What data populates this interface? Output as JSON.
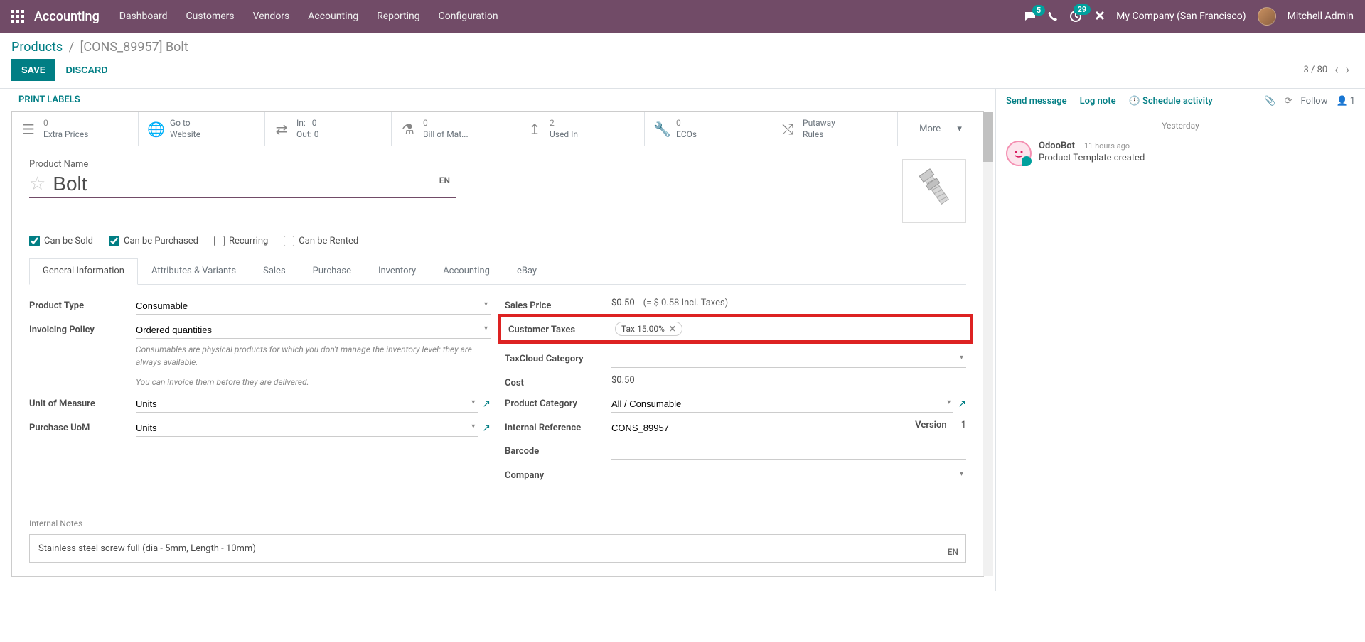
{
  "nav": {
    "brand": "Accounting",
    "items": [
      "Dashboard",
      "Customers",
      "Vendors",
      "Accounting",
      "Reporting",
      "Configuration"
    ],
    "msg_badge": "5",
    "clock_badge": "29",
    "company": "My Company (San Francisco)",
    "user": "Mitchell Admin"
  },
  "breadcrumb": {
    "root": "Products",
    "current": "[CONS_89957] Bolt"
  },
  "actions": {
    "save": "SAVE",
    "discard": "DISCARD"
  },
  "pager": {
    "pos": "3 / 80"
  },
  "controlbar": {
    "print": "PRINT LABELS"
  },
  "stats": {
    "extra_count": "0",
    "extra_label": "Extra Prices",
    "web_l1": "Go to",
    "web_l2": "Website",
    "in_l": "In:",
    "in_v": "0",
    "out_l": "Out:",
    "out_v": "0",
    "bom_count": "0",
    "bom_label": "Bill of Mat...",
    "used_count": "2",
    "used_label": "Used In",
    "eco_count": "0",
    "eco_label": "ECOs",
    "put_l1": "Putaway",
    "put_l2": "Rules",
    "more": "More"
  },
  "product": {
    "name_label": "Product Name",
    "name": "Bolt",
    "lang": "EN",
    "can_sold": "Can be Sold",
    "can_purchased": "Can be Purchased",
    "recurring": "Recurring",
    "can_rented": "Can be Rented"
  },
  "tabs": [
    "General Information",
    "Attributes & Variants",
    "Sales",
    "Purchase",
    "Inventory",
    "Accounting",
    "eBay"
  ],
  "fields": {
    "product_type_l": "Product Type",
    "product_type_v": "Consumable",
    "inv_policy_l": "Invoicing Policy",
    "inv_policy_v": "Ordered quantities",
    "help1": "Consumables are physical products for which you don't manage the inventory level: they are always available.",
    "help2": "You can invoice them before they are delivered.",
    "uom_l": "Unit of Measure",
    "uom_v": "Units",
    "puom_l": "Purchase UoM",
    "puom_v": "Units",
    "sales_price_l": "Sales Price",
    "sales_price_v": "$0.50",
    "sales_incl": "(= $ 0.58 Incl. Taxes)",
    "cust_tax_l": "Customer Taxes",
    "cust_tax_tag": "Tax 15.00%",
    "taxcloud_l": "TaxCloud Category",
    "cost_l": "Cost",
    "cost_v": "$0.50",
    "prod_cat_l": "Product Category",
    "prod_cat_v": "All / Consumable",
    "int_ref_l": "Internal Reference",
    "int_ref_v": "CONS_89957",
    "version_l": "Version",
    "version_v": "1",
    "barcode_l": "Barcode",
    "company_l": "Company",
    "notes_l": "Internal Notes",
    "notes_v": "Stainless steel screw full (dia - 5mm, Length - 10mm)",
    "lang2": "EN"
  },
  "chatter": {
    "send": "Send message",
    "log": "Log note",
    "schedule": "Schedule activity",
    "follow": "Follow",
    "followers": "1",
    "day": "Yesterday",
    "author": "OdooBot",
    "time": "- 11 hours ago",
    "msg": "Product Template created"
  }
}
